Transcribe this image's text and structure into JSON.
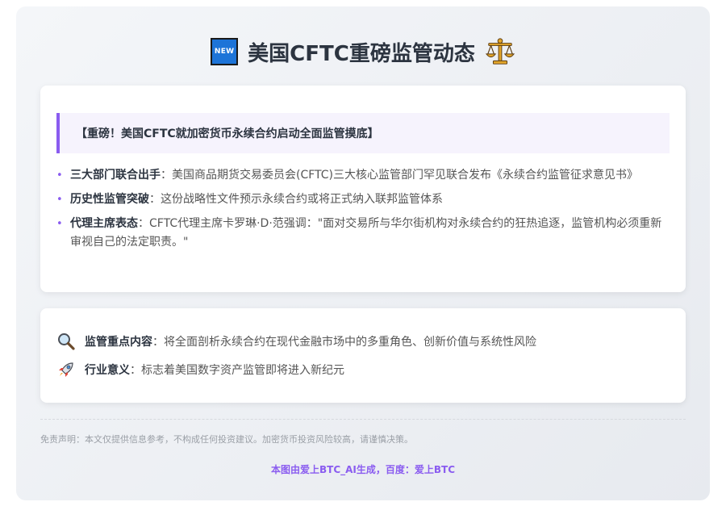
{
  "header": {
    "badge_text": "NEW",
    "title": "美国CFTC重磅监管动态",
    "icons": [
      "new-badge-icon",
      "balance-scale-icon"
    ]
  },
  "news_card": {
    "headline": "【重磅！美国CFTC就加密货币永续合约启动全面监管摸底】",
    "bullets": [
      {
        "label": "三大部门联合出手",
        "text": "：美国商品期货交易委员会(CFTC)三大核心监管部门罕见联合发布《永续合约监管征求意见书》"
      },
      {
        "label": "历史性监管突破",
        "text": "：这份战略性文件预示永续合约或将正式纳入联邦监管体系"
      },
      {
        "label": "代理主席表态",
        "text": "：CFTC代理主席卡罗琳·D·范强调：\"面对交易所与华尔街机构对永续合约的狂热追逐，监管机构必须重新审视自己的法定职责。\""
      }
    ]
  },
  "focus_card": {
    "items": [
      {
        "icon": "magnifying-glass-icon",
        "label": "监管重点内容",
        "text": "：将全面剖析永续合约在现代金融市场中的多重角色、创新价值与系统性风险"
      },
      {
        "icon": "rocket-icon",
        "label": "行业意义",
        "text": "：标志着美国数字资产监管即将进入新纪元"
      }
    ]
  },
  "disclaimer": "免责声明：本文仅提供信息参考，不构成任何投资建议。加密货币投资风险较高，请谨慎决策。",
  "footer": "本图由爱上BTC_AI生成，百度：爱上BTC",
  "colors": {
    "accent": "#8a5cf0",
    "title": "#2c3440",
    "banner_bg": "#f6f3fd"
  }
}
